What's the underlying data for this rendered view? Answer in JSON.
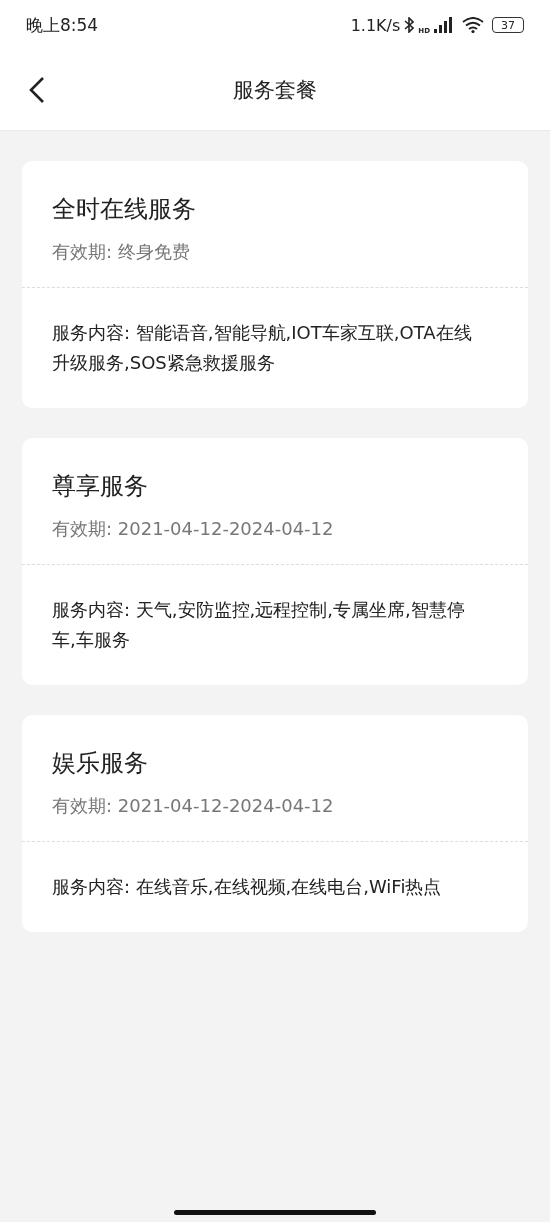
{
  "status_bar": {
    "time": "晚上8:54",
    "speed": "1.1K/s",
    "network_badge": "HD",
    "battery": "37"
  },
  "header": {
    "title": "服务套餐"
  },
  "packages": [
    {
      "name": "全时在线服务",
      "validity": "有效期: 终身免费",
      "content": "服务内容: 智能语音,智能导航,IOT车家互联,OTA在线升级服务,SOS紧急救援服务"
    },
    {
      "name": "尊享服务",
      "validity": "有效期: 2021-04-12-2024-04-12",
      "content": "服务内容: 天气,安防监控,远程控制,专属坐席,智慧停车,车服务"
    },
    {
      "name": "娱乐服务",
      "validity": "有效期: 2021-04-12-2024-04-12",
      "content": "服务内容: 在线音乐,在线视频,在线电台,WiFi热点"
    }
  ]
}
